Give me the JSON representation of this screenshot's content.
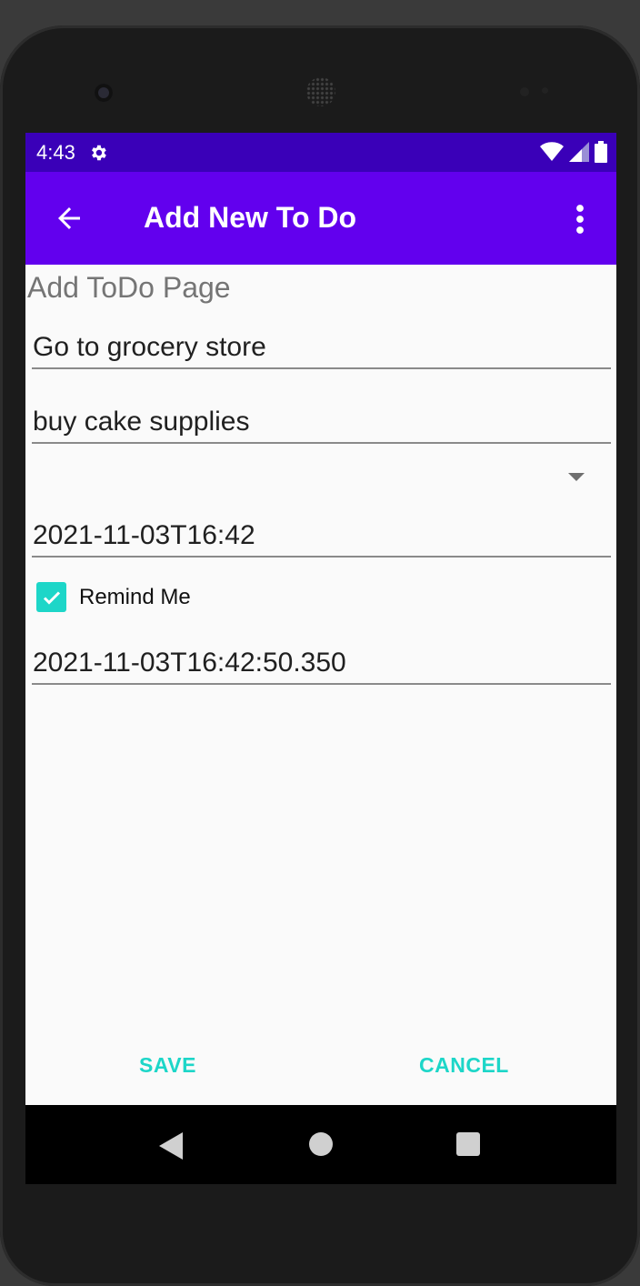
{
  "status_bar": {
    "time": "4:43",
    "settings_icon": "gear-icon",
    "wifi_icon": "wifi-icon",
    "signal_icon": "signal-icon",
    "battery_icon": "battery-icon"
  },
  "app_bar": {
    "title": "Add New To Do",
    "back_icon": "arrow-back-icon",
    "overflow_icon": "more-vert-icon"
  },
  "form": {
    "page_label": "Add ToDo Page",
    "title_value": "Go to grocery store",
    "description_value": "buy cake supplies",
    "category_selected": "",
    "due_date_value": "2021-11-03T16:42",
    "remind_checked": true,
    "remind_label": "Remind Me",
    "reminder_time_value": "2021-11-03T16:42:50.350"
  },
  "actions": {
    "save_label": "SAVE",
    "cancel_label": "CANCEL"
  },
  "colors": {
    "status_bar": "#3a00b8",
    "app_bar": "#6200ee",
    "accent": "#1dd6c8"
  }
}
